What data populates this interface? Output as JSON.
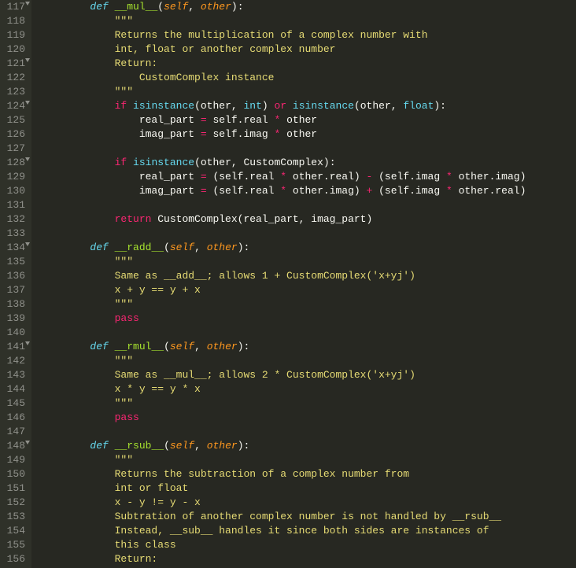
{
  "gutter": {
    "start": 117,
    "end": 156,
    "fold_lines": [
      117,
      121,
      124,
      128,
      134,
      141,
      148
    ]
  },
  "code": {
    "lines": [
      {
        "indent": 2,
        "tokens": [
          [
            "def",
            "def"
          ],
          [
            "sp",
            " "
          ],
          [
            "fn",
            "__mul__"
          ],
          [
            "punct",
            "("
          ],
          [
            "param",
            "self"
          ],
          [
            "punct",
            ", "
          ],
          [
            "param",
            "other"
          ],
          [
            "punct",
            "):"
          ]
        ]
      },
      {
        "indent": 3,
        "tokens": [
          [
            "str",
            "\"\"\""
          ]
        ]
      },
      {
        "indent": 3,
        "tokens": [
          [
            "str",
            "Returns the multiplication of a complex number with"
          ]
        ]
      },
      {
        "indent": 3,
        "tokens": [
          [
            "str",
            "int, float or another complex number"
          ]
        ]
      },
      {
        "indent": 3,
        "tokens": [
          [
            "str",
            "Return:"
          ]
        ]
      },
      {
        "indent": 3,
        "tokens": [
          [
            "str",
            "    CustomComplex instance"
          ]
        ]
      },
      {
        "indent": 3,
        "tokens": [
          [
            "str",
            "\"\"\""
          ]
        ]
      },
      {
        "indent": 3,
        "tokens": [
          [
            "kw",
            "if"
          ],
          [
            "sp",
            " "
          ],
          [
            "builtin",
            "isinstance"
          ],
          [
            "punct",
            "(other, "
          ],
          [
            "builtin",
            "int"
          ],
          [
            "punct",
            ") "
          ],
          [
            "op",
            "or"
          ],
          [
            "sp",
            " "
          ],
          [
            "builtin",
            "isinstance"
          ],
          [
            "punct",
            "(other, "
          ],
          [
            "builtin",
            "float"
          ],
          [
            "punct",
            "):"
          ]
        ]
      },
      {
        "indent": 4,
        "tokens": [
          [
            "punct",
            "real_part "
          ],
          [
            "op",
            "="
          ],
          [
            "punct",
            " self.real "
          ],
          [
            "op",
            "*"
          ],
          [
            "punct",
            " other"
          ]
        ]
      },
      {
        "indent": 4,
        "tokens": [
          [
            "punct",
            "imag_part "
          ],
          [
            "op",
            "="
          ],
          [
            "punct",
            " self.imag "
          ],
          [
            "op",
            "*"
          ],
          [
            "punct",
            " other"
          ]
        ]
      },
      {
        "indent": 0,
        "tokens": []
      },
      {
        "indent": 3,
        "tokens": [
          [
            "kw",
            "if"
          ],
          [
            "sp",
            " "
          ],
          [
            "builtin",
            "isinstance"
          ],
          [
            "punct",
            "(other, CustomComplex):"
          ]
        ]
      },
      {
        "indent": 4,
        "tokens": [
          [
            "punct",
            "real_part "
          ],
          [
            "op",
            "="
          ],
          [
            "punct",
            " (self.real "
          ],
          [
            "op",
            "*"
          ],
          [
            "punct",
            " other.real) "
          ],
          [
            "op",
            "-"
          ],
          [
            "punct",
            " (self.imag "
          ],
          [
            "op",
            "*"
          ],
          [
            "punct",
            " other.imag)"
          ]
        ]
      },
      {
        "indent": 4,
        "tokens": [
          [
            "punct",
            "imag_part "
          ],
          [
            "op",
            "="
          ],
          [
            "punct",
            " (self.real "
          ],
          [
            "op",
            "*"
          ],
          [
            "punct",
            " other.imag) "
          ],
          [
            "op",
            "+"
          ],
          [
            "punct",
            " (self.imag "
          ],
          [
            "op",
            "*"
          ],
          [
            "punct",
            " other.real)"
          ]
        ]
      },
      {
        "indent": 0,
        "tokens": []
      },
      {
        "indent": 3,
        "tokens": [
          [
            "kw",
            "return"
          ],
          [
            "punct",
            " CustomComplex(real_part, imag_part)"
          ]
        ]
      },
      {
        "indent": 0,
        "tokens": []
      },
      {
        "indent": 2,
        "tokens": [
          [
            "def",
            "def"
          ],
          [
            "sp",
            " "
          ],
          [
            "fn",
            "__radd__"
          ],
          [
            "punct",
            "("
          ],
          [
            "param",
            "self"
          ],
          [
            "punct",
            ", "
          ],
          [
            "param",
            "other"
          ],
          [
            "punct",
            "):"
          ]
        ]
      },
      {
        "indent": 3,
        "tokens": [
          [
            "str",
            "\"\"\""
          ]
        ]
      },
      {
        "indent": 3,
        "tokens": [
          [
            "str",
            "Same as __add__; allows 1 + CustomComplex('x+yj')"
          ]
        ]
      },
      {
        "indent": 3,
        "tokens": [
          [
            "str",
            "x + y == y + x"
          ]
        ]
      },
      {
        "indent": 3,
        "tokens": [
          [
            "str",
            "\"\"\""
          ]
        ]
      },
      {
        "indent": 3,
        "tokens": [
          [
            "kw",
            "pass"
          ]
        ]
      },
      {
        "indent": 0,
        "tokens": []
      },
      {
        "indent": 2,
        "tokens": [
          [
            "def",
            "def"
          ],
          [
            "sp",
            " "
          ],
          [
            "fn",
            "__rmul__"
          ],
          [
            "punct",
            "("
          ],
          [
            "param",
            "self"
          ],
          [
            "punct",
            ", "
          ],
          [
            "param",
            "other"
          ],
          [
            "punct",
            "):"
          ]
        ]
      },
      {
        "indent": 3,
        "tokens": [
          [
            "str",
            "\"\"\""
          ]
        ]
      },
      {
        "indent": 3,
        "tokens": [
          [
            "str",
            "Same as __mul__; allows 2 * CustomComplex('x+yj')"
          ]
        ]
      },
      {
        "indent": 3,
        "tokens": [
          [
            "str",
            "x * y == y * x"
          ]
        ]
      },
      {
        "indent": 3,
        "tokens": [
          [
            "str",
            "\"\"\""
          ]
        ]
      },
      {
        "indent": 3,
        "tokens": [
          [
            "kw",
            "pass"
          ]
        ]
      },
      {
        "indent": 0,
        "tokens": []
      },
      {
        "indent": 2,
        "tokens": [
          [
            "def",
            "def"
          ],
          [
            "sp",
            " "
          ],
          [
            "fn",
            "__rsub__"
          ],
          [
            "punct",
            "("
          ],
          [
            "param",
            "self"
          ],
          [
            "punct",
            ", "
          ],
          [
            "param",
            "other"
          ],
          [
            "punct",
            "):"
          ]
        ]
      },
      {
        "indent": 3,
        "tokens": [
          [
            "str",
            "\"\"\""
          ]
        ]
      },
      {
        "indent": 3,
        "tokens": [
          [
            "str",
            "Returns the subtraction of a complex number from"
          ]
        ]
      },
      {
        "indent": 3,
        "tokens": [
          [
            "str",
            "int or float"
          ]
        ]
      },
      {
        "indent": 3,
        "tokens": [
          [
            "str",
            "x - y != y - x"
          ]
        ]
      },
      {
        "indent": 3,
        "tokens": [
          [
            "str",
            "Subtration of another complex number is not handled by __rsub__"
          ]
        ]
      },
      {
        "indent": 3,
        "tokens": [
          [
            "str",
            "Instead, __sub__ handles it since both sides are instances of"
          ]
        ]
      },
      {
        "indent": 3,
        "tokens": [
          [
            "str",
            "this class"
          ]
        ]
      },
      {
        "indent": 3,
        "tokens": [
          [
            "str",
            "Return:"
          ]
        ]
      }
    ]
  }
}
